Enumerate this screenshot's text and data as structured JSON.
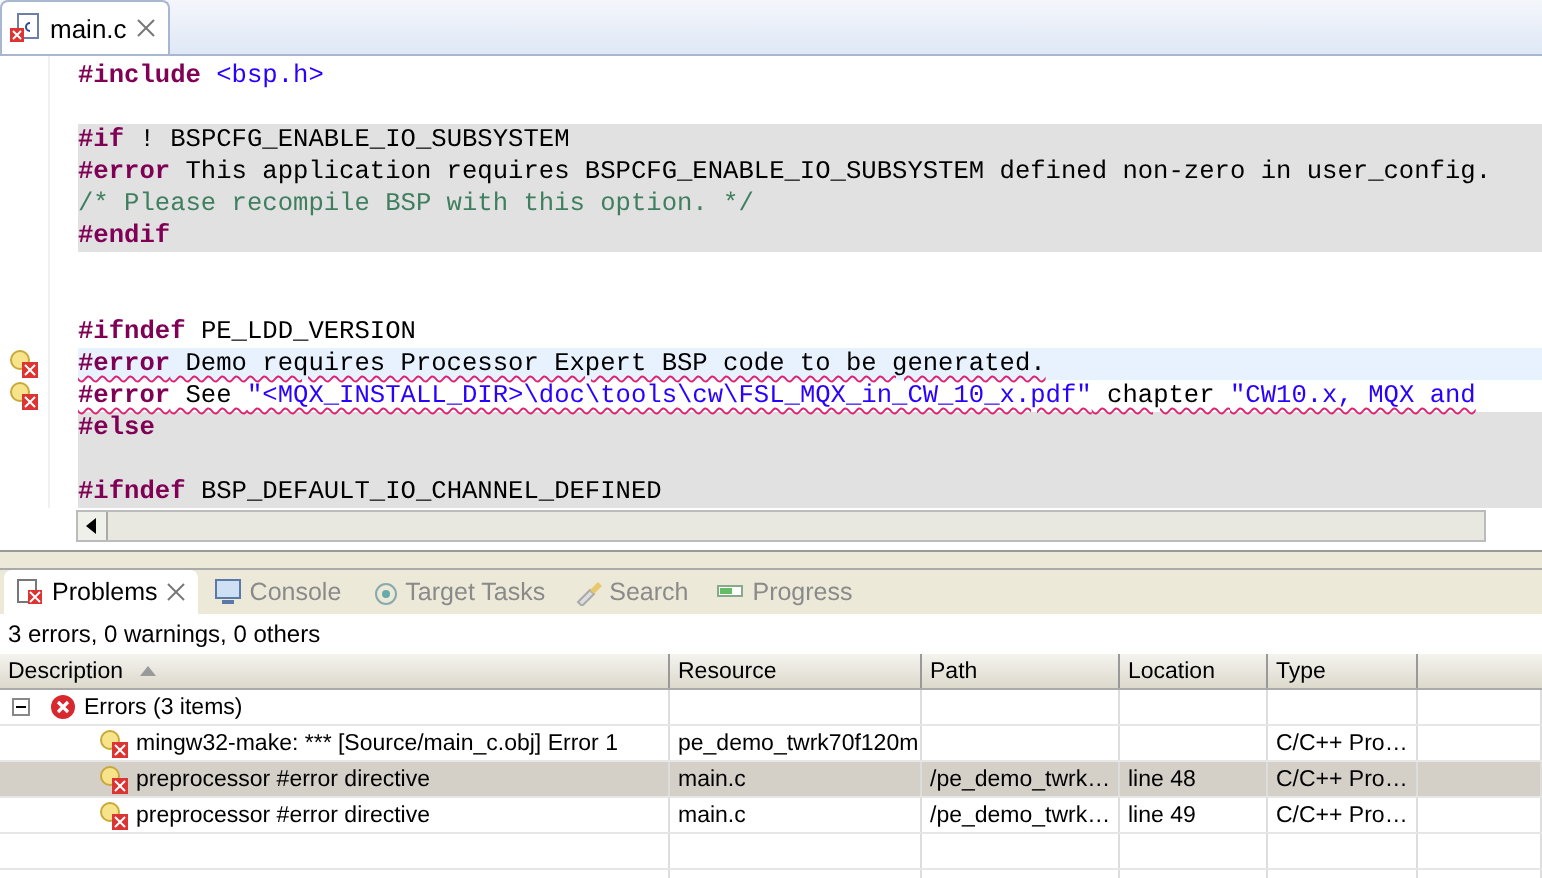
{
  "editor": {
    "tab": {
      "label": "main.c",
      "selected": true,
      "has_error": true
    },
    "lines": [
      {
        "tokens": [
          {
            "kind": "directive",
            "text": "#include"
          },
          {
            "kind": "string",
            "text": " <bsp.h>"
          }
        ],
        "inactive": false,
        "error": false,
        "current": false
      },
      {
        "inactive": false,
        "error": false,
        "current": false
      },
      {
        "tokens": [
          {
            "kind": "directive",
            "text": "#if"
          },
          {
            "kind": "plain",
            "text": " ! BSPCFG_ENABLE_IO_SUBSYSTEM"
          }
        ],
        "inactive": true,
        "error": false,
        "current": false
      },
      {
        "tokens": [
          {
            "kind": "directive",
            "text": "#error"
          },
          {
            "kind": "plain",
            "text": " This application requires BSPCFG_ENABLE_IO_SUBSYSTEM defined non-zero in user_config."
          }
        ],
        "inactive": true,
        "error": false,
        "current": false
      },
      {
        "tokens": [
          {
            "kind": "comment",
            "text": "/* Please recompile BSP with this option. */"
          }
        ],
        "inactive": true,
        "error": false,
        "current": false
      },
      {
        "tokens": [
          {
            "kind": "directive",
            "text": "#endif"
          }
        ],
        "inactive": true,
        "error": false,
        "current": false
      },
      {
        "inactive": false,
        "error": false,
        "current": false
      },
      {
        "inactive": false,
        "error": false,
        "current": false
      },
      {
        "tokens": [
          {
            "kind": "directive",
            "text": "#ifndef"
          },
          {
            "kind": "plain",
            "text": " PE_LDD_VERSION"
          }
        ],
        "inactive": false,
        "error": false,
        "current": false
      },
      {
        "tokens": [
          {
            "kind": "directive",
            "text": "#error"
          },
          {
            "kind": "plain",
            "text": " Demo requires Processor Expert BSP code to be generated."
          }
        ],
        "inactive": false,
        "error": true,
        "current": true
      },
      {
        "tokens": [
          {
            "kind": "directive",
            "text": "#error"
          },
          {
            "kind": "plain",
            "text": " See "
          },
          {
            "kind": "string",
            "text": "\"<MQX_INSTALL_DIR>\\doc\\tools\\cw\\FSL_MQX_in_CW_10_x.pdf\""
          },
          {
            "kind": "plain",
            "text": " chapter "
          },
          {
            "kind": "string",
            "text": "\"CW10.x, MQX and"
          }
        ],
        "inactive": false,
        "error": true,
        "current": false
      },
      {
        "tokens": [
          {
            "kind": "directive",
            "text": "#else"
          }
        ],
        "inactive": true,
        "error": false,
        "current": false
      },
      {
        "inactive": true,
        "error": false,
        "current": false
      },
      {
        "tokens": [
          {
            "kind": "directive",
            "text": "#ifndef"
          },
          {
            "kind": "plain",
            "text": " BSP_DEFAULT_IO_CHANNEL_DEFINED"
          }
        ],
        "inactive": true,
        "error": false,
        "current": false
      }
    ]
  },
  "panel": {
    "tabs": [
      {
        "label": "Problems",
        "selected": true
      },
      {
        "label": "Console",
        "selected": false
      },
      {
        "label": "Target Tasks",
        "selected": false
      },
      {
        "label": "Search",
        "selected": false
      },
      {
        "label": "Progress",
        "selected": false
      }
    ],
    "summary": "3 errors, 0 warnings, 0 others",
    "columns": [
      "Description",
      "Resource",
      "Path",
      "Location",
      "Type"
    ],
    "rows": [
      {
        "description": "Errors (3 items)",
        "expanded": true,
        "selected": false,
        "children": [
          {
            "description": "mingw32-make: *** [Source/main_c.obj] Error 1",
            "resource": "pe_demo_twrk70f120m",
            "type": "C/C++ Pro…",
            "selected": false
          },
          {
            "description": "preprocessor #error directive",
            "resource": "main.c",
            "path": "/pe_demo_twrk…",
            "location": "line 48",
            "type": "C/C++ Pro…",
            "selected": true
          },
          {
            "description": "preprocessor #error directive",
            "resource": "main.c",
            "path": "/pe_demo_twrk…",
            "location": "line 49",
            "type": "C/C++ Pro…",
            "selected": false
          }
        ]
      }
    ]
  }
}
